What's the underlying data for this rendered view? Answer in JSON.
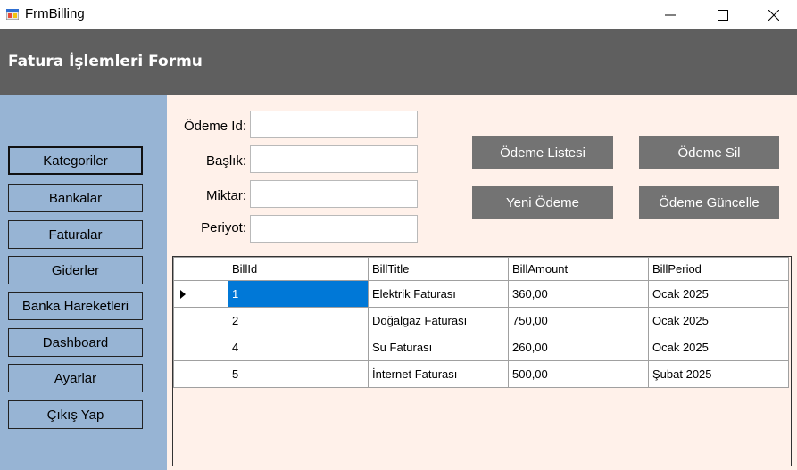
{
  "window": {
    "title": "FrmBilling",
    "icon": "app-form-icon",
    "controls": [
      "minimize-icon",
      "maximize-icon",
      "close-icon"
    ]
  },
  "header": {
    "title": "Fatura İşlemleri Formu",
    "bg": "#5f5f5f"
  },
  "sidebar": {
    "bg": "#97b4d4",
    "items": [
      {
        "label": "Kategoriler",
        "active": true
      },
      {
        "label": "Bankalar"
      },
      {
        "label": "Faturalar"
      },
      {
        "label": "Giderler"
      },
      {
        "label": "Banka Hareketleri"
      },
      {
        "label": "Dashboard"
      },
      {
        "label": "Ayarlar"
      },
      {
        "label": "Çıkış Yap"
      }
    ]
  },
  "form": {
    "fields": [
      {
        "label": "Ödeme Id:",
        "value": ""
      },
      {
        "label": "Başlık:",
        "value": ""
      },
      {
        "label": "Miktar:",
        "value": ""
      },
      {
        "label": "Periyot:",
        "value": ""
      }
    ]
  },
  "actions": {
    "list": "Ödeme Listesi",
    "delete": "Ödeme Sil",
    "new": "Yeni Ödeme",
    "update": "Ödeme Güncelle"
  },
  "grid": {
    "columns": [
      "BillId",
      "BillTitle",
      "BillAmount",
      "BillPeriod"
    ],
    "rows": [
      [
        "1",
        "Elektrik Faturası",
        "360,00",
        "Ocak 2025"
      ],
      [
        "2",
        "Doğalgaz Faturası",
        "750,00",
        "Ocak 2025"
      ],
      [
        "4",
        "Su Faturası",
        "260,00",
        "Ocak 2025"
      ],
      [
        "5",
        "İnternet Faturası",
        "500,00",
        "Şubat 2025"
      ]
    ],
    "selected_row": 0,
    "selection_color": "#0078d7"
  }
}
